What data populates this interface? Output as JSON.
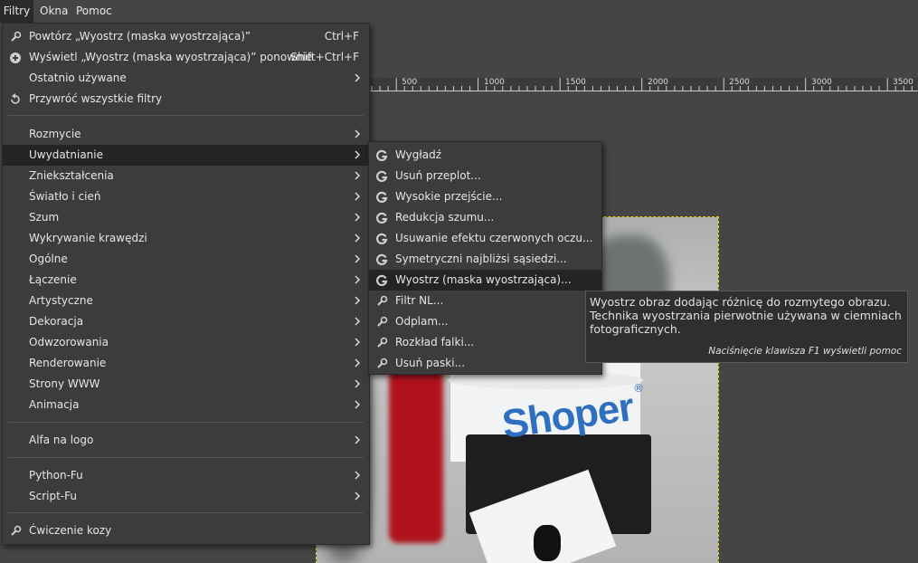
{
  "menubar": {
    "items": [
      {
        "label": "Filtry"
      },
      {
        "label": "Okna"
      },
      {
        "label": "Pomoc"
      }
    ]
  },
  "ruler": {
    "labels": [
      "500",
      "1000",
      "1500",
      "2000",
      "2500",
      "3000",
      "3500"
    ]
  },
  "filters_menu": {
    "repeat": {
      "label": "Powtórz „Wyostrz (maska wyostrzająca)”",
      "accel": "Ctrl+F"
    },
    "reshow": {
      "label": "Wyświetl „Wyostrz (maska wyostrzająca)” ponownie",
      "accel": "Shift+Ctrl+F"
    },
    "recent": {
      "label": "Ostatnio używane"
    },
    "reset": {
      "label": "Przywróć wszystkie filtry"
    },
    "categories": [
      {
        "label": "Rozmycie"
      },
      {
        "label": "Uwydatnianie"
      },
      {
        "label": "Zniekształcenia"
      },
      {
        "label": "Światło i cień"
      },
      {
        "label": "Szum"
      },
      {
        "label": "Wykrywanie krawędzi"
      },
      {
        "label": "Ogólne"
      },
      {
        "label": "Łączenie"
      },
      {
        "label": "Artystyczne"
      },
      {
        "label": "Dekoracja"
      },
      {
        "label": "Odwzorowania"
      },
      {
        "label": "Renderowanie"
      },
      {
        "label": "Strony WWW"
      },
      {
        "label": "Animacja"
      }
    ],
    "alpha_to_logo": {
      "label": "Alfa na logo"
    },
    "python_fu": {
      "label": "Python-Fu"
    },
    "script_fu": {
      "label": "Script-Fu"
    },
    "goat": {
      "label": "Ćwiczenie kozy"
    }
  },
  "enhance_submenu": {
    "items": [
      {
        "label": "Wygładź",
        "icon": "gegl-icon"
      },
      {
        "label": "Usuń przeplot...",
        "icon": "gegl-icon"
      },
      {
        "label": "Wysokie przejście...",
        "icon": "gegl-icon"
      },
      {
        "label": "Redukcja szumu...",
        "icon": "gegl-icon"
      },
      {
        "label": "Usuwanie efektu czerwonych oczu...",
        "icon": "gegl-icon"
      },
      {
        "label": "Symetryczni najbliżsi sąsiedzi...",
        "icon": "gegl-icon"
      },
      {
        "label": "Wyostrz (maska wyostrzająca)...",
        "icon": "gegl-icon"
      },
      {
        "label": "Filtr NL...",
        "icon": "plugin-icon"
      },
      {
        "label": "Odplam...",
        "icon": "plugin-icon"
      },
      {
        "label": "Rozkład falki...",
        "icon": "plugin-icon"
      },
      {
        "label": "Usuń paski...",
        "icon": "plugin-icon"
      }
    ]
  },
  "tooltip": {
    "text": "Wyostrz obraz dodając różnicę do rozmytego obrazu. Technika wyostrzania pierwotnie używana w ciemniach fotograficznych.",
    "help_hint": "Naciśnięcie klawisza F1 wyświetli pomoc"
  },
  "photo": {
    "brand_text": "Shoper",
    "registered_mark": "®"
  },
  "colors": {
    "menu_bg": "#3c3c3c",
    "highlight_bg": "#242424",
    "brand_blue": "#2f6fc0",
    "selection_dash": "#e5d000"
  }
}
